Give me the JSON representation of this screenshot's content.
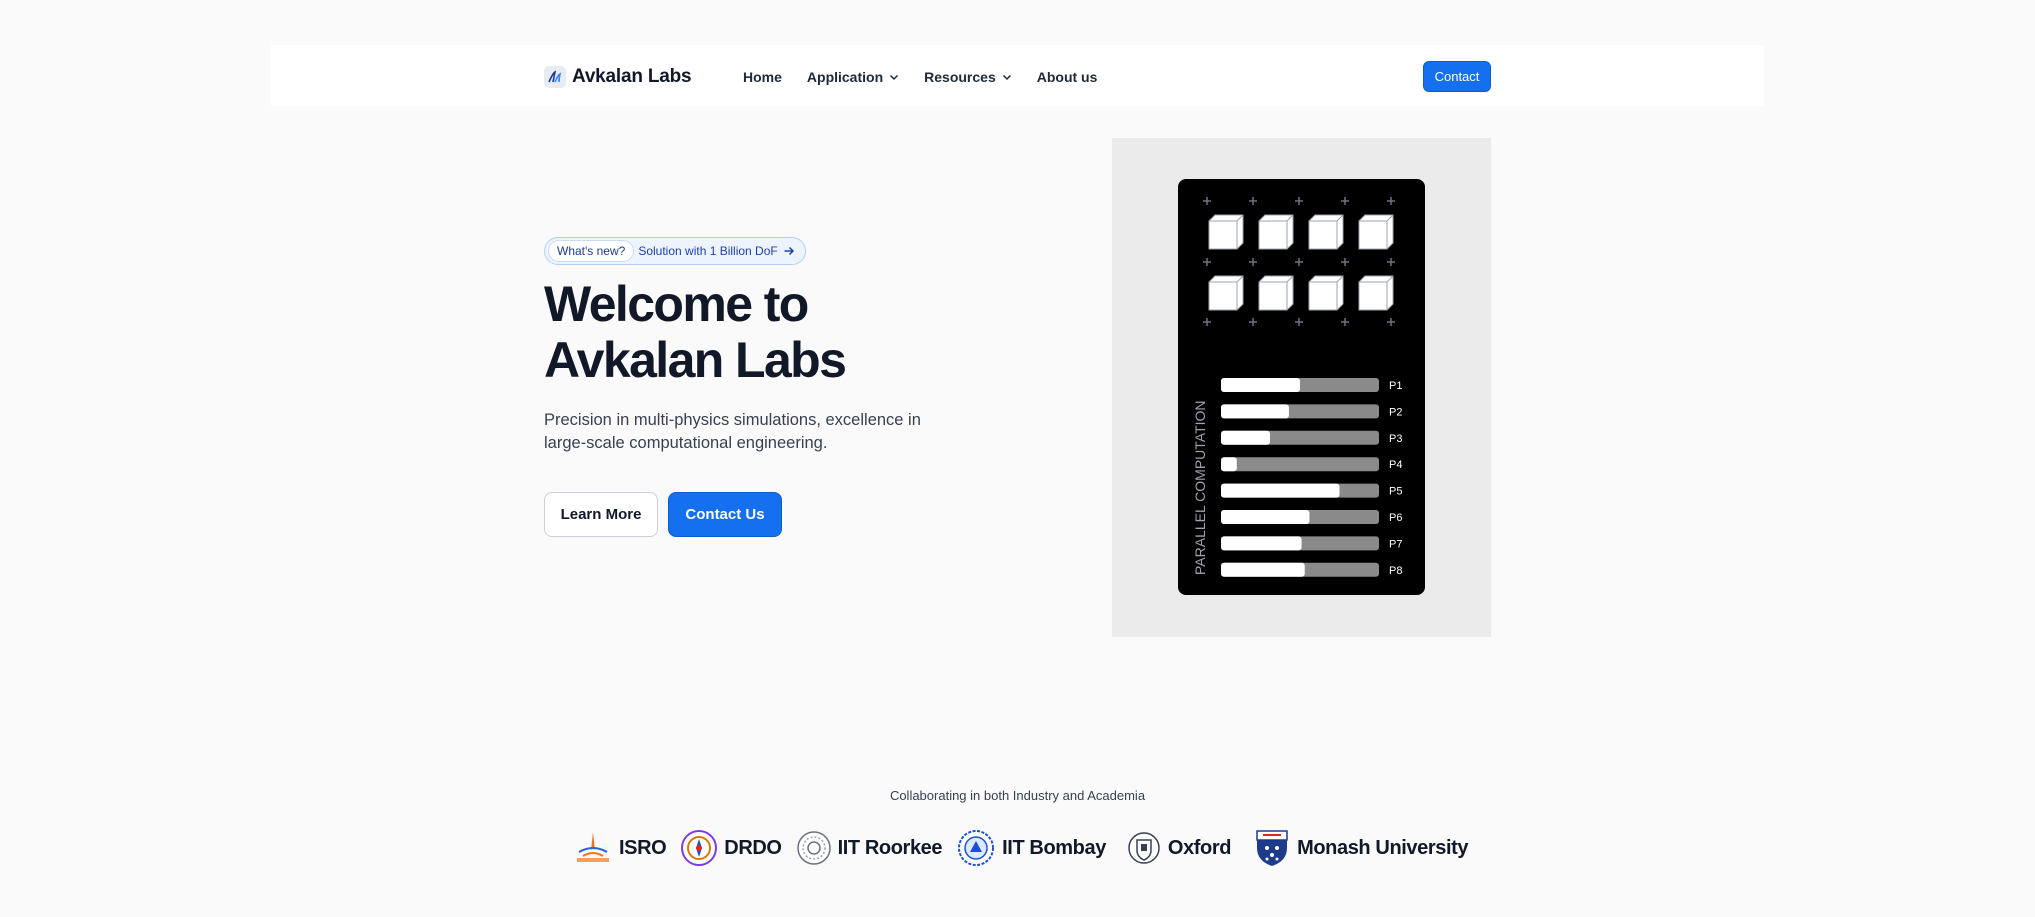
{
  "brand": {
    "name": "Avkalan Labs"
  },
  "nav": {
    "items": [
      {
        "label": "Home",
        "has_dropdown": false
      },
      {
        "label": "Application",
        "has_dropdown": true
      },
      {
        "label": "Resources",
        "has_dropdown": true
      },
      {
        "label": "About us",
        "has_dropdown": false
      }
    ],
    "contact_label": "Contact"
  },
  "hero": {
    "badge_tag": "What's new?",
    "badge_text": "Solution with 1 Billion DoF",
    "title_line1": "Welcome to",
    "title_line2": "Avkalan Labs",
    "subtitle": "Precision in multi-physics simulations, excellence in large-scale computational engineering.",
    "learn_more_label": "Learn More",
    "contact_us_label": "Contact Us"
  },
  "illustration": {
    "vertical_label": "PARALLEL COMPUTATION",
    "processors": [
      {
        "label": "P1",
        "progress": 0.5
      },
      {
        "label": "P2",
        "progress": 0.43
      },
      {
        "label": "P3",
        "progress": 0.31
      },
      {
        "label": "P4",
        "progress": 0.1
      },
      {
        "label": "P5",
        "progress": 0.75
      },
      {
        "label": "P6",
        "progress": 0.56
      },
      {
        "label": "P7",
        "progress": 0.51
      },
      {
        "label": "P8",
        "progress": 0.53
      }
    ],
    "cube_rows": 2,
    "cubes_per_row": 4
  },
  "partners": {
    "label": "Collaborating in both Industry and Academia",
    "items": [
      {
        "name": "ISRO",
        "icon": "isro-logo"
      },
      {
        "name": "DRDO",
        "icon": "drdo-seal"
      },
      {
        "name": "IIT Roorkee",
        "icon": "iit-roorkee-seal"
      },
      {
        "name": "IIT Bombay",
        "icon": "iit-bombay-seal"
      },
      {
        "name": "Oxford",
        "icon": "oxford-crest"
      },
      {
        "name": "Monash University",
        "icon": "monash-shield"
      }
    ]
  },
  "colors": {
    "accent": "#1570ef",
    "text": "#111827",
    "background": "#fafafa"
  }
}
